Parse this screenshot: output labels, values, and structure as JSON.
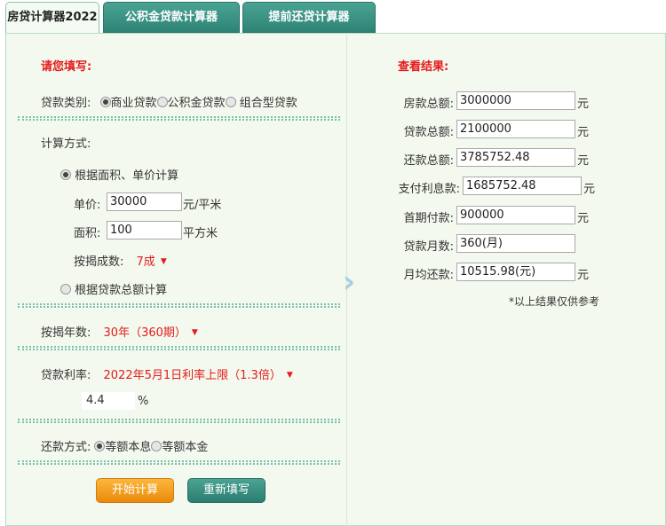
{
  "tabs": [
    {
      "label": "房贷计算器2022"
    },
    {
      "label": "公积金贷款计算器"
    },
    {
      "label": "提前还贷计算器"
    }
  ],
  "form": {
    "title": "请您填写:",
    "loan_type_label": "贷款类别:",
    "loan_types": [
      "商业贷款",
      "公积金贷款",
      "组合型贷款"
    ],
    "calc_method_label": "计算方式:",
    "method_area": "根据面积、单价计算",
    "unit_price_label": "单价:",
    "unit_price_value": "30000",
    "unit_price_unit": "元/平米",
    "area_label": "面积:",
    "area_value": "100",
    "area_unit": "平方米",
    "mortgage_ratio_label": "按揭成数:",
    "mortgage_ratio_value": "7成",
    "method_total": "根据贷款总额计算",
    "years_label": "按揭年数:",
    "years_value": "30年（360期）",
    "rate_label": "贷款利率:",
    "rate_value": "2022年5月1日利率上限（1.3倍）",
    "rate_input": "4.4",
    "rate_unit": "%",
    "repay_label": "还款方式:",
    "repay_options": [
      "等额本息",
      "等额本金"
    ],
    "start_button": "开始计算",
    "reset_button": "重新填写"
  },
  "results": {
    "title": "查看结果:",
    "unit": "元",
    "rows": [
      {
        "label": "房款总额:",
        "value": "3000000",
        "unit": "元"
      },
      {
        "label": "贷款总额:",
        "value": "2100000",
        "unit": "元"
      },
      {
        "label": "还款总额:",
        "value": "3785752.48",
        "unit": "元"
      },
      {
        "label": "支付利息款:",
        "value": "1685752.48",
        "unit": "元"
      },
      {
        "label": "首期付款:",
        "value": "900000",
        "unit": "元"
      },
      {
        "label": "贷款月数:",
        "value": "360(月)",
        "unit": ""
      },
      {
        "label": "月均还款:",
        "value": "10515.98(元)",
        "unit": "元"
      }
    ],
    "note": "*以上结果仅供参考"
  }
}
